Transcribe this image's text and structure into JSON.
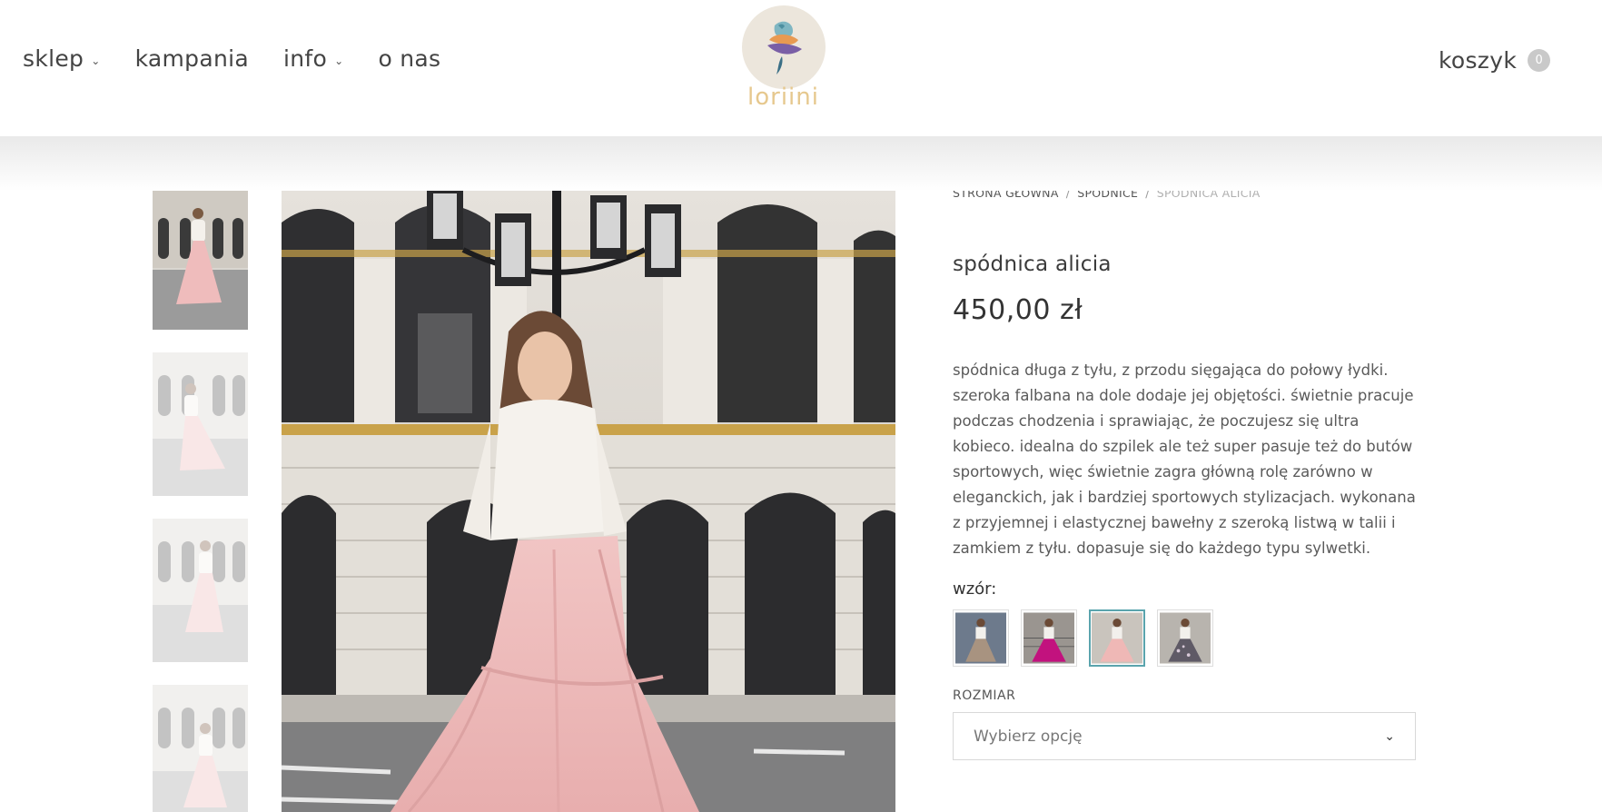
{
  "nav": {
    "items": [
      {
        "label": "sklep",
        "has_dropdown": true
      },
      {
        "label": "kampania",
        "has_dropdown": false
      },
      {
        "label": "info",
        "has_dropdown": true
      },
      {
        "label": "o nas",
        "has_dropdown": false
      }
    ],
    "chevron": "⌄"
  },
  "logo": {
    "text": "loriini",
    "icon": "parrot-logo-icon",
    "colors": {
      "circle": "#ece6dc",
      "text": "#e6c88e"
    }
  },
  "cart": {
    "label": "koszyk",
    "count": "0"
  },
  "breadcrumb": {
    "items": [
      "STRONA GŁÓWNA",
      "SPÓDNICE",
      "SPÓDNICA ALICIA"
    ],
    "separator": "/"
  },
  "product": {
    "title": "spódnica alicia",
    "price": "450,00 zł",
    "description": "spódnica długa z tyłu, z przodu sięgająca do połowy łydki. szeroka falbana na dole dodaje jej objętości. świetnie pracuje podczas chodzenia i sprawiając, że poczujesz się ultra kobieco. idealna do szpilek ale też super pasuje też do butów sportowych, więc świetnie zagra główną rolę zarówno w eleganckich, jak i bardziej sportowych stylizacjach. wykonana z przyjemnej i elastycznej bawełny z szeroką listwą w talii i zamkiem z tyłu. dopasuje się do każdego typu sylwetki.",
    "pattern_label": "wzór:",
    "swatches": [
      {
        "name": "beige-pattern",
        "skirt_color": "#a89380",
        "active": false
      },
      {
        "name": "magenta",
        "skirt_color": "#c2127e",
        "active": false
      },
      {
        "name": "pink",
        "skirt_color": "#efb8b6",
        "active": true
      },
      {
        "name": "dark-floral",
        "skirt_color": "#5f5a66",
        "active": false
      }
    ],
    "size_label": "ROZMIAR",
    "size_select": {
      "value": "Wybierz opcję",
      "chevron": "⌄"
    }
  },
  "colors": {
    "accent": "#5aa4ad",
    "text": "#4a4a4a",
    "skirt_pink": "#efbcbc"
  }
}
